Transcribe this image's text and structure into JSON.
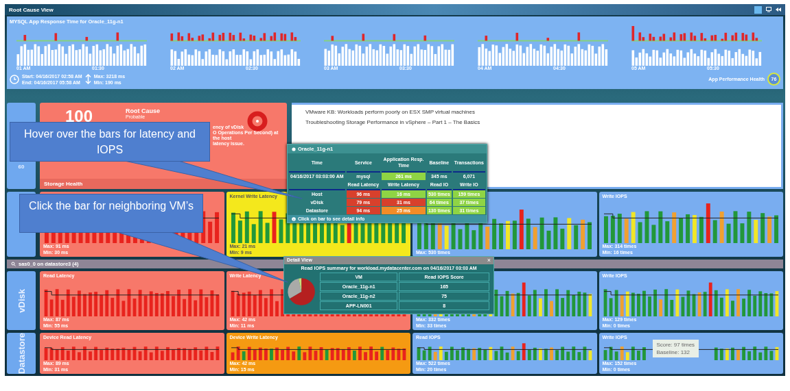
{
  "window": {
    "title": "Root Cause View"
  },
  "response_chart": {
    "title": "MYSQL App Response Time for Oracle_11g-n1",
    "time_labels": [
      "01 AM",
      "01:30",
      "02 AM",
      "02:30",
      "03 AM",
      "03:30",
      "04 AM",
      "04:30",
      "05 AM",
      "05:30"
    ],
    "start": "Start: 04/16/2017 02:58 AM",
    "end": "End: 04/16/2017 05:58 AM",
    "max": "Max: 3218 ms",
    "min": "Min: 190 ms",
    "health_label": "App Performance Health",
    "health_score": "76"
  },
  "storage_health": {
    "tile_score": "60",
    "score": "100",
    "title": "Root Cause",
    "subtitle": "Probable",
    "description_lines": [
      "ency of vDisk",
      "O Operations Per Second) at the host",
      "latency issue."
    ],
    "label": "Storage Health"
  },
  "kb_links": [
    "VMware KB: Workloads perform poorly on ESX SMP virtual machines",
    "Troubleshooting Storage Performance in vSphere – Part 1 – The Basics"
  ],
  "rows": [
    {
      "cards": [
        {
          "kind": "critical",
          "max": "Max: 91 ms",
          "min": "Min: 30 ms"
        },
        {
          "title": "Kernel Write Latency",
          "kind": "warning",
          "max": "Max: 21 ms",
          "min": "Min: 9 ms"
        },
        {
          "kind": "normal",
          "max": "Max: 530 times"
        },
        {
          "title": "Write IOPS",
          "kind": "normal",
          "max": "Max: 314 times",
          "min": "Min: 16 times"
        }
      ]
    },
    {
      "group": "sas0_0 on datastore3 (4)",
      "label": "vDisk",
      "cards": [
        {
          "title": "Read Latency",
          "kind": "critical",
          "max": "Max: 87 ms",
          "min": "Min: 55 ms"
        },
        {
          "title": "Write Latency",
          "kind": "critical",
          "max": "Max: 42 ms",
          "min": "Min: 11 ms"
        },
        {
          "kind": "normal",
          "max": "Max: 332 times",
          "min": "Min: 33 times"
        },
        {
          "title": "Write IOPS",
          "kind": "normal",
          "max": "Max: 129 times",
          "min": "Min: 0 times"
        }
      ]
    },
    {
      "label": "Datastore",
      "cards": [
        {
          "title": "Device Read Latency",
          "kind": "critical",
          "max": "Max: 89 ms",
          "min": "Min: 31 ms"
        },
        {
          "title": "Device Write Latency",
          "kind": "major",
          "max": "Max: 42 ms",
          "min": "Min: 15 ms"
        },
        {
          "title": "Read IOPS",
          "kind": "normal",
          "max": "Max: 522 times",
          "min": "Min: 20 times"
        },
        {
          "title": "Write IOPS",
          "kind": "normal",
          "max": "Max: 152 times",
          "min": "Min: 0 times",
          "hover": {
            "score": "Score: 97 times",
            "baseline": "Baseline: 132"
          }
        }
      ]
    }
  ],
  "tooltip_popup": {
    "title": "Oracle_11g-n1",
    "columns": [
      "Time",
      "Service",
      "Application Resp. Time",
      "Baseline",
      "Transactions"
    ],
    "row": [
      {
        "text": "04/16/2017 03:03:00 AM"
      },
      {
        "text": "mysql"
      },
      {
        "text": "261 ms",
        "color": "#8fd444"
      },
      {
        "text": "345 ms"
      },
      {
        "text": "6,071"
      }
    ],
    "io_columns": [
      "Read Latency",
      "Write Latency",
      "Read IO",
      "Write IO"
    ],
    "io_rows": [
      {
        "label": "Host",
        "cells": [
          {
            "text": "96 ms",
            "color": "#d8402c"
          },
          {
            "text": "16 ms",
            "color": "#8fd444"
          },
          {
            "text": "530 times",
            "color": "#8fd444"
          },
          {
            "text": "159 times",
            "color": "#8fd444"
          }
        ]
      },
      {
        "label": "vDisk",
        "cells": [
          {
            "text": "79 ms",
            "color": "#d8402c"
          },
          {
            "text": "31 ms",
            "color": "#d8402c"
          },
          {
            "text": "64 times",
            "color": "#8fd444"
          },
          {
            "text": "37 times",
            "color": "#8fd444"
          }
        ]
      },
      {
        "label": "Datastore",
        "cells": [
          {
            "text": "94 ms",
            "color": "#d8402c"
          },
          {
            "text": "25 ms",
            "color": "#f28c28"
          },
          {
            "text": "130 times",
            "color": "#8fd444"
          },
          {
            "text": "31 times",
            "color": "#8fd444"
          }
        ]
      }
    ],
    "footer": "Click on bar to see detail info"
  },
  "detail_popup": {
    "title": "Detail View",
    "close": "×",
    "summary": "Read IOPS summary for workload.mydatacenter.com on 04/16/2017 03:03 AM",
    "columns": [
      "VM",
      "Read IOPS Score"
    ],
    "rows": [
      {
        "vm": "Oracle_11g-n1",
        "score": "165"
      },
      {
        "vm": "Oracle_11g-n2",
        "score": "75"
      },
      {
        "vm": "APP-LN001",
        "score": "8"
      }
    ],
    "chart_data": {
      "type": "pie",
      "values": [
        66.53,
        30.24,
        3.23
      ]
    }
  },
  "callouts": [
    {
      "text": "Hover over the bars for latency and IOPS"
    },
    {
      "text": "Click the bar for neighboring VM’s"
    }
  ]
}
